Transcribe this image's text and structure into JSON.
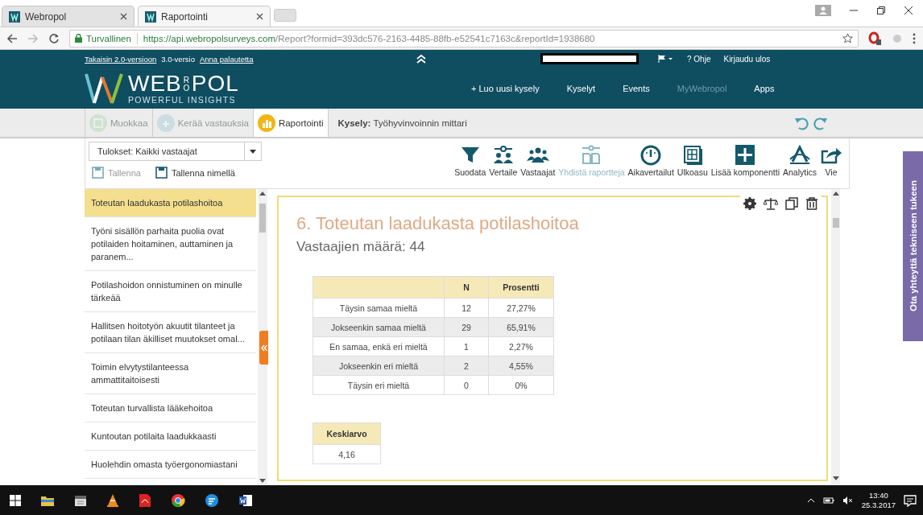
{
  "browser": {
    "tabs": [
      {
        "label": "Webropol",
        "selected": false
      },
      {
        "label": "Raportointi",
        "selected": true
      }
    ],
    "address": {
      "secure_label": "Turvallinen",
      "host": "https://api.webropolsurveys.com",
      "path": "/Report?formid=393dc576-2163-4485-88fb-e52541c7163c&reportId=1938680"
    }
  },
  "header": {
    "top_links": [
      {
        "label": "Takaisin 2.0-versioon",
        "kind": "link"
      },
      {
        "label": "3.0-versio",
        "kind": "text"
      },
      {
        "label": "Anna palautetta",
        "kind": "link"
      }
    ],
    "logo": {
      "left": "WEB",
      "stacked": "RO",
      "right": "POL",
      "tagline": "POWERFUL INSIGHTS"
    },
    "help": "? Ohje",
    "logout": "Kirjaudu ulos",
    "nav": [
      {
        "label": "+ Luo uusi kysely",
        "disabled": false
      },
      {
        "label": "Kyselyt",
        "disabled": false
      },
      {
        "label": "Events",
        "disabled": false
      },
      {
        "label": "MyWebropol",
        "disabled": true
      },
      {
        "label": "Apps",
        "disabled": false
      }
    ]
  },
  "steps": [
    {
      "label": "Muokkaa",
      "selected": false,
      "disabled": true
    },
    {
      "label": "Kerää vastauksia",
      "selected": false,
      "disabled": true
    },
    {
      "label": "Raportointi",
      "selected": true,
      "disabled": false
    }
  ],
  "survey": {
    "label": "Kysely:",
    "name": "Työhyvinvoinnin mittari"
  },
  "results_select": {
    "value": "Tulokset: Kaikki vastaajat"
  },
  "save_buttons": [
    {
      "label": "Tallenna",
      "disabled": true
    },
    {
      "label": "Tallenna nimellä",
      "disabled": false
    }
  ],
  "actions": [
    {
      "label": "Suodata",
      "disabled": false
    },
    {
      "label": "Vertaile",
      "disabled": false
    },
    {
      "label": "Vastaajat",
      "disabled": false
    },
    {
      "label": "Yhdistä raportteja",
      "disabled": true
    },
    {
      "label": "Aikavertailut",
      "disabled": false
    },
    {
      "label": "Ulkoasu",
      "disabled": false
    },
    {
      "label": "Lisää komponentti",
      "disabled": false
    },
    {
      "label": "Analytics",
      "disabled": false
    },
    {
      "label": "Vie",
      "disabled": false
    }
  ],
  "sidebar": {
    "items": [
      {
        "label": "Toteutan laadukasta potilashoitoa",
        "selected": true
      },
      {
        "label": "Työni sisällön parhaita puolia ovat potilaiden hoitaminen, auttaminen ja paranem...",
        "selected": false
      },
      {
        "label": "Potilashoidon onnistuminen on minulle tärkeää",
        "selected": false
      },
      {
        "label": "Hallitsen hoitotyön akuutit tilanteet ja potilaan tilan äkilliset muutokset omal...",
        "selected": false
      },
      {
        "label": "Toimin elvytystilanteessa ammattitaitoisesti",
        "selected": false
      },
      {
        "label": "Toteutan turvallista lääkehoitoa",
        "selected": false
      },
      {
        "label": "Kuntoutan potilaita laadukkaasti",
        "selected": false
      },
      {
        "label": "Huolehdin omasta työergonomiastani",
        "selected": false
      }
    ]
  },
  "question": {
    "title": "6. Toteutan laadukasta potilashoitoa",
    "respondents": "Vastaajien määrä: 44",
    "table": {
      "columns": [
        "N",
        "Prosentti"
      ],
      "rows": [
        {
          "label": "Täysin samaa mieltä",
          "n": "12",
          "percent": "27,27%"
        },
        {
          "label": "Jokseenkin samaa mieltä",
          "n": "29",
          "percent": "65,91%"
        },
        {
          "label": "En samaa, enkä eri mieltä",
          "n": "1",
          "percent": "2,27%"
        },
        {
          "label": "Jokseenkin eri mieltä",
          "n": "2",
          "percent": "4,55%"
        },
        {
          "label": "Täysin eri mieltä",
          "n": "0",
          "percent": "0%"
        }
      ]
    },
    "mean": {
      "label": "Keskiarvo",
      "value": "4,16"
    }
  },
  "support_tab": "Ota yhteyttä tekniseen tukeen",
  "taskbar": {
    "time": "13:40",
    "date": "25.3.2017"
  }
}
